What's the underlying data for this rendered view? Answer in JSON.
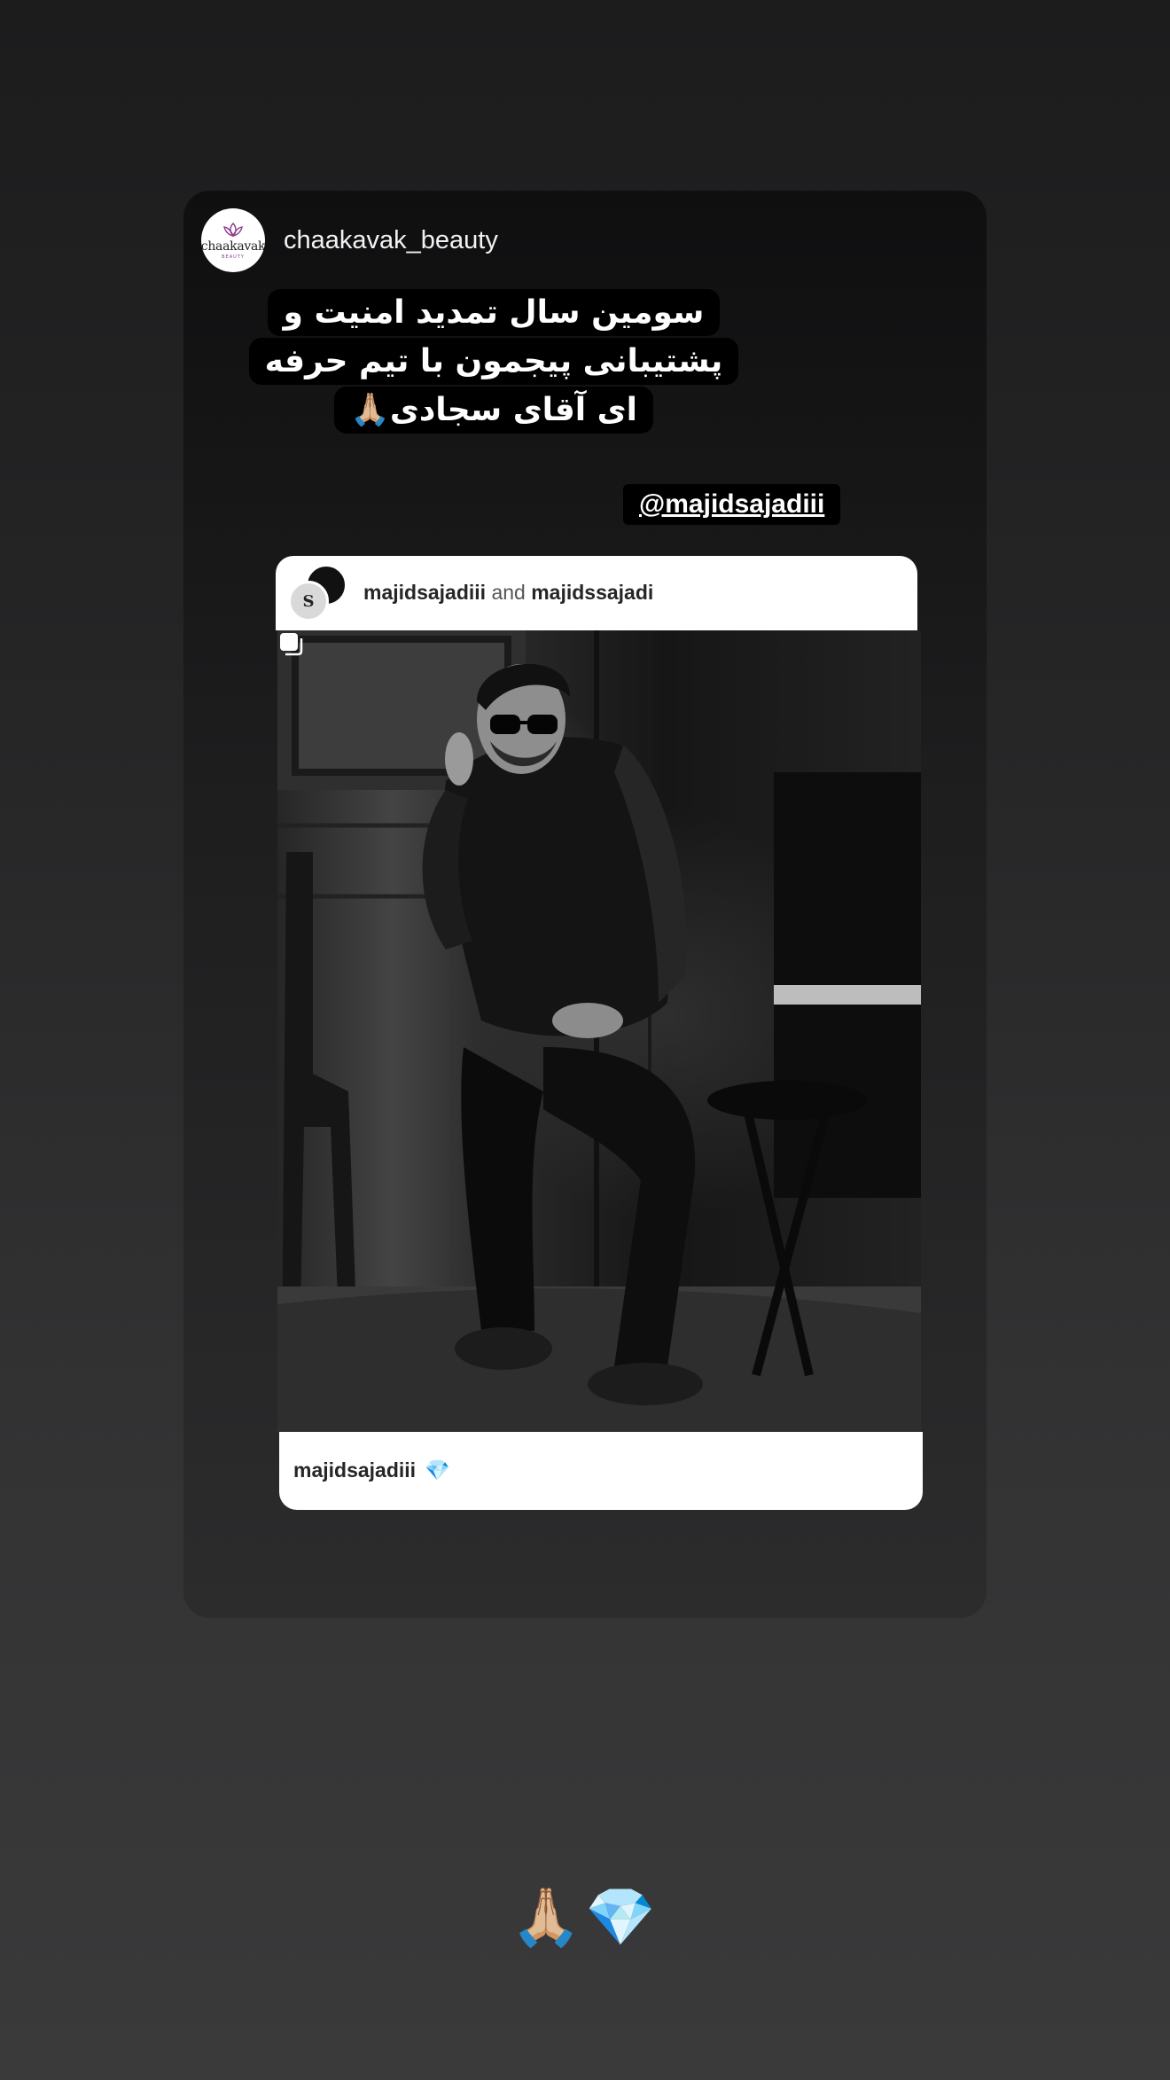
{
  "story": {
    "account_name": "chaakavak_beauty",
    "avatar_brand": "chaakavak",
    "avatar_sub": "BEAUTY",
    "caption": "سومین سال تمدید امنیت و پشتیبانی پیجمون با تیم حرفه ای آقای سجادی🙏🏼",
    "mention": "@majidsajadiii"
  },
  "post": {
    "author_1": "majidsajadiii",
    "connector": "and",
    "author_2": "majidssajadi",
    "avatar_letter": "S",
    "footer_user": "majidsajadiii",
    "footer_emoji": "💎",
    "multi_icon": "carousel-icon"
  },
  "bottom": {
    "emojis": "🙏🏼💎"
  },
  "colors": {
    "background": "#2b2b2c",
    "card": "#1a1a1b",
    "accent_logo": "#8b3b8a"
  }
}
